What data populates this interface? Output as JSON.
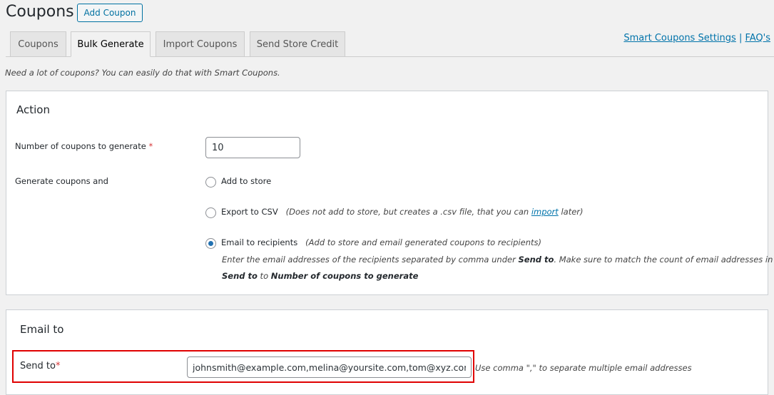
{
  "header": {
    "title": "Coupons",
    "add_button": "Add Coupon"
  },
  "tabs": [
    {
      "label": "Coupons",
      "active": false
    },
    {
      "label": "Bulk Generate",
      "active": true
    },
    {
      "label": "Import Coupons",
      "active": false
    },
    {
      "label": "Send Store Credit",
      "active": false
    }
  ],
  "links": {
    "settings": "Smart Coupons Settings",
    "separator": "|",
    "faq": "FAQ's"
  },
  "description": "Need a lot of coupons? You can easily do that with Smart Coupons.",
  "action": {
    "heading": "Action",
    "count_label": "Number of coupons to generate",
    "required_mark": "*",
    "count_value": "10",
    "generate_label": "Generate coupons and",
    "options": [
      {
        "label": "Add to store",
        "selected": false
      },
      {
        "label": "Export to CSV",
        "selected": false,
        "note_pre": "(Does not add to store, but creates a .csv file, that you can ",
        "note_link": "import",
        "note_post": " later)"
      },
      {
        "label": "Email to recipients",
        "selected": true,
        "note": "(Add to store and email generated coupons to recipients)"
      }
    ],
    "help": {
      "p1": "Enter the email addresses of the recipients separated by comma under ",
      "b1": "Send to",
      "p2": ". Make sure to match the count of email addresses in",
      "b2": "Send to",
      "p3": " to ",
      "b3": "Number of coupons to generate"
    }
  },
  "email": {
    "heading": "Email to",
    "send_to_label": "Send to",
    "required_mark": "*",
    "send_to_value": "johnsmith@example.com,melina@yoursite.com,tom@xyz.com",
    "hint": "Use comma \",\" to separate multiple email addresses",
    "highlight_color": "#e00000"
  }
}
